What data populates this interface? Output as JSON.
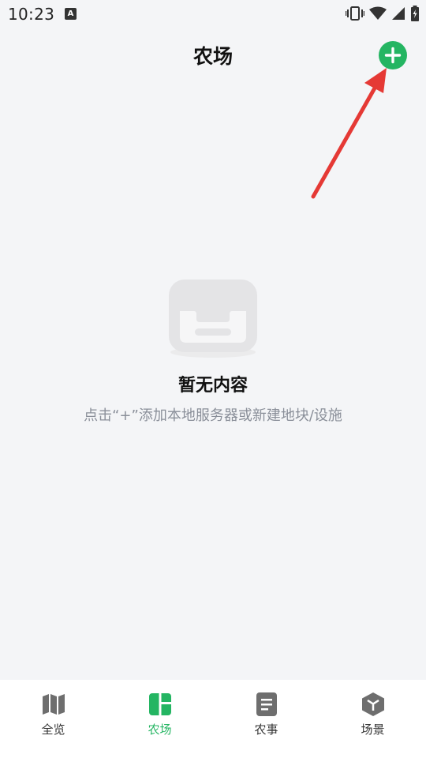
{
  "status_bar": {
    "time": "10:23",
    "notification_icon": "A"
  },
  "header": {
    "title": "农场",
    "add_button_icon": "plus-icon"
  },
  "empty_state": {
    "icon": "inbox-icon",
    "title": "暂无内容",
    "hint": "点击“+”添加本地服务器或新建地块/设施"
  },
  "bottom_nav": {
    "items": [
      {
        "label": "全览",
        "icon": "map-icon",
        "active": false
      },
      {
        "label": "农场",
        "icon": "dashboard-icon",
        "active": true
      },
      {
        "label": "农事",
        "icon": "document-icon",
        "active": false
      },
      {
        "label": "场景",
        "icon": "cube-icon",
        "active": false
      }
    ]
  },
  "colors": {
    "accent": "#24b562",
    "background": "#f4f5f7",
    "annotation": "#e53935",
    "hint_text": "#8a8f99"
  }
}
